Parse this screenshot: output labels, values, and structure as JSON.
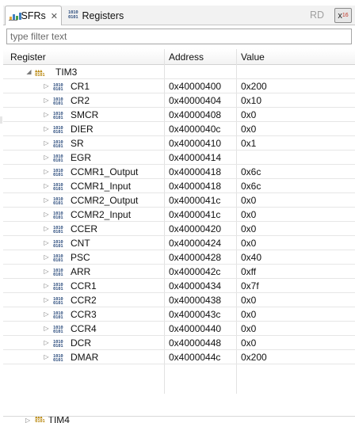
{
  "tabs": [
    {
      "label": "SFRs",
      "icon": "sfr-chart-icon",
      "active": true,
      "close": "✕"
    },
    {
      "label": "Registers",
      "icon": "register-bits-icon",
      "active": false
    }
  ],
  "toolbar": {
    "rd_label": "RD",
    "hex_label": "x",
    "hex_sub": "16"
  },
  "filter": {
    "placeholder": "type filter text",
    "value": ""
  },
  "columns": {
    "register": "Register",
    "address": "Address",
    "value": "Value"
  },
  "group": {
    "name": "TIM3",
    "expanded": true
  },
  "registers": [
    {
      "name": "CR1",
      "address": "0x40000400",
      "value": "0x200"
    },
    {
      "name": "CR2",
      "address": "0x40000404",
      "value": "0x10"
    },
    {
      "name": "SMCR",
      "address": "0x40000408",
      "value": "0x0"
    },
    {
      "name": "DIER",
      "address": "0x4000040c",
      "value": "0x0"
    },
    {
      "name": "SR",
      "address": "0x40000410",
      "value": "0x1"
    },
    {
      "name": "EGR",
      "address": "0x40000414",
      "value": ""
    },
    {
      "name": "CCMR1_Output",
      "address": "0x40000418",
      "value": "0x6c"
    },
    {
      "name": "CCMR1_Input",
      "address": "0x40000418",
      "value": "0x6c"
    },
    {
      "name": "CCMR2_Output",
      "address": "0x4000041c",
      "value": "0x0"
    },
    {
      "name": "CCMR2_Input",
      "address": "0x4000041c",
      "value": "0x0"
    },
    {
      "name": "CCER",
      "address": "0x40000420",
      "value": "0x0"
    },
    {
      "name": "CNT",
      "address": "0x40000424",
      "value": "0x0"
    },
    {
      "name": "PSC",
      "address": "0x40000428",
      "value": "0x40"
    },
    {
      "name": "ARR",
      "address": "0x4000042c",
      "value": "0xff"
    },
    {
      "name": "CCR1",
      "address": "0x40000434",
      "value": "0x7f"
    },
    {
      "name": "CCR2",
      "address": "0x40000438",
      "value": "0x0"
    },
    {
      "name": "CCR3",
      "address": "0x4000043c",
      "value": "0x0"
    },
    {
      "name": "CCR4",
      "address": "0x40000440",
      "value": "0x0"
    },
    {
      "name": "DCR",
      "address": "0x40000448",
      "value": "0x0"
    },
    {
      "name": "DMAR",
      "address": "0x4000044c",
      "value": "0x200"
    }
  ],
  "next_group": {
    "name": "TIM4"
  }
}
